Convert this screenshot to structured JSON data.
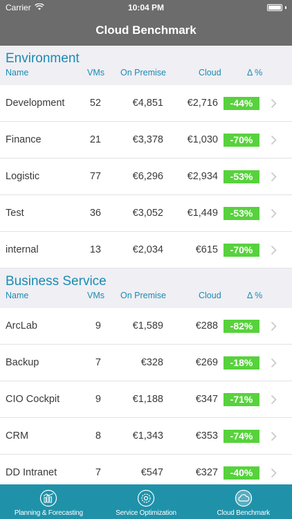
{
  "status_bar": {
    "carrier": "Carrier",
    "time": "10:04 PM"
  },
  "nav": {
    "title": "Cloud Benchmark"
  },
  "columns": {
    "name": "Name",
    "vms": "VMs",
    "on_premise": "On Premise",
    "cloud": "Cloud",
    "delta": "Δ %"
  },
  "sections": [
    {
      "title": "Environment",
      "rows": [
        {
          "name": "Development",
          "vms": "52",
          "on_premise": "€4,851",
          "cloud": "€2,716",
          "delta": "-44%"
        },
        {
          "name": "Finance",
          "vms": "21",
          "on_premise": "€3,378",
          "cloud": "€1,030",
          "delta": "-70%"
        },
        {
          "name": "Logistic",
          "vms": "77",
          "on_premise": "€6,296",
          "cloud": "€2,934",
          "delta": "-53%"
        },
        {
          "name": "Test",
          "vms": "36",
          "on_premise": "€3,052",
          "cloud": "€1,449",
          "delta": "-53%"
        },
        {
          "name": "internal",
          "vms": "13",
          "on_premise": "€2,034",
          "cloud": "€615",
          "delta": "-70%"
        }
      ]
    },
    {
      "title": "Business Service",
      "rows": [
        {
          "name": "ArcLab",
          "vms": "9",
          "on_premise": "€1,589",
          "cloud": "€288",
          "delta": "-82%"
        },
        {
          "name": "Backup",
          "vms": "7",
          "on_premise": "€328",
          "cloud": "€269",
          "delta": "-18%"
        },
        {
          "name": "CIO Cockpit",
          "vms": "9",
          "on_premise": "€1,188",
          "cloud": "€347",
          "delta": "-71%"
        },
        {
          "name": "CRM",
          "vms": "8",
          "on_premise": "€1,343",
          "cloud": "€353",
          "delta": "-74%"
        },
        {
          "name": "DD Intranet",
          "vms": "7",
          "on_premise": "€547",
          "cloud": "€327",
          "delta": "-40%"
        }
      ]
    }
  ],
  "tabs": [
    {
      "label": "Planning & Forecasting",
      "icon": "chart-icon"
    },
    {
      "label": "Service Optimization",
      "icon": "gear-icon"
    },
    {
      "label": "Cloud Benchmark",
      "icon": "cloud-icon"
    }
  ],
  "colors": {
    "accent": "#1a8bb3",
    "header_bar": "#6c6c6c",
    "tab_bar": "#1f92aa",
    "delta_badge": "#57d23c"
  }
}
